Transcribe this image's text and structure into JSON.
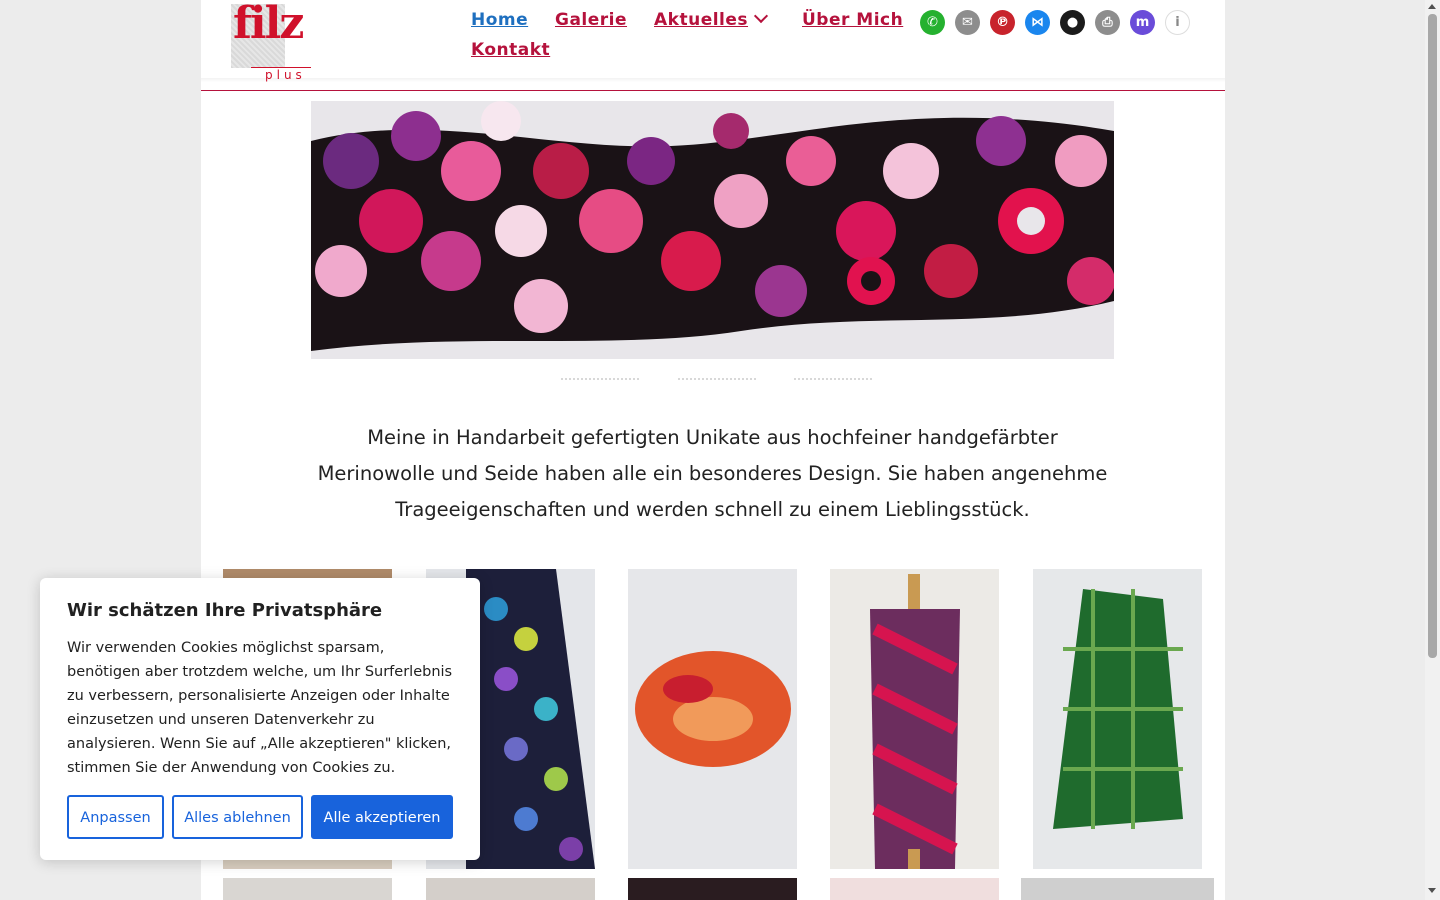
{
  "logo": {
    "main": "filz",
    "sub": "plus"
  },
  "nav": {
    "items": [
      {
        "label": "Home"
      },
      {
        "label": "Galerie"
      },
      {
        "label": "Aktuelles"
      },
      {
        "label": "Über Mich"
      },
      {
        "label": "Kontakt"
      }
    ]
  },
  "share": [
    {
      "icon": "whatsapp-icon",
      "color": "#25b12f"
    },
    {
      "icon": "email-icon",
      "color": "#8d8d8d"
    },
    {
      "icon": "pinterest-icon",
      "color": "#c8232c"
    },
    {
      "icon": "bluesky-icon",
      "color": "#1a86ee"
    },
    {
      "icon": "threema-icon",
      "color": "#1b1b1b"
    },
    {
      "icon": "print-icon",
      "color": "#8d8d8d"
    },
    {
      "icon": "mastodon-icon",
      "color": "#6a4cd9"
    },
    {
      "icon": "info-icon",
      "color": "#ffffff"
    }
  ],
  "intro": "Meine in Handarbeit gefertigten Unikate aus hochfeiner handgefärbter Merinowolle und Seide haben alle ein besonderes Design. Sie haben angenehme Trageeigenschaften und werden schnell zu einem Lieblingsstück.",
  "cookie": {
    "title": "Wir schätzen Ihre Privatsphäre",
    "text": "Wir verwenden Cookies möglichst sparsam, benötigen aber trotzdem welche, um Ihr Surferlebnis zu verbessern, personalisierte Anzeigen oder Inhalte einzusetzen und unseren Datenverkehr zu analysieren. Wenn Sie auf „Alle akzeptieren\" klicken, stimmen Sie der Anwendung von Cookies zu.",
    "customize": "Anpassen",
    "reject": "Alles ablehnen",
    "accept": "Alle akzeptieren"
  }
}
